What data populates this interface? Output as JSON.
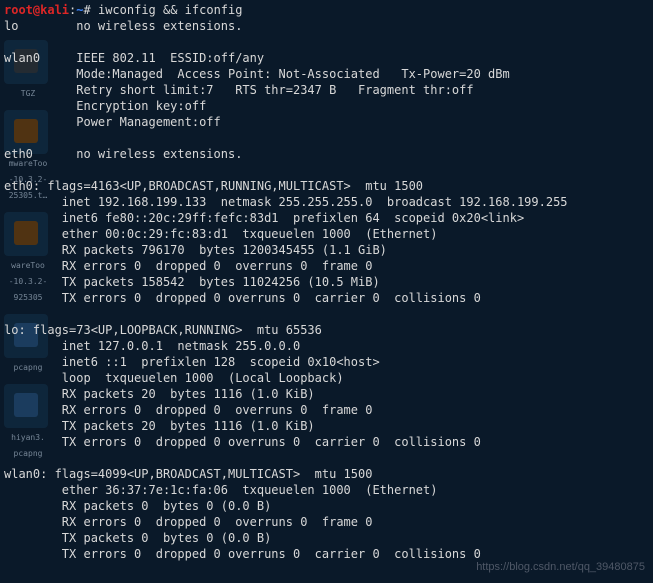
{
  "prompt_user": "root@kali",
  "prompt_path": "~",
  "prompt_sep": ":",
  "prompt_hash": "#",
  "command": "iwconfig && ifconfig",
  "iwconfig": {
    "lo": "lo        no wireless extensions.",
    "wlan0_l1": "wlan0     IEEE 802.11  ESSID:off/any",
    "wlan0_l2": "          Mode:Managed  Access Point: Not-Associated   Tx-Power=20 dBm",
    "wlan0_l3": "          Retry short limit:7   RTS thr=2347 B   Fragment thr:off",
    "wlan0_l4": "          Encryption key:off",
    "wlan0_l5": "          Power Management:off",
    "eth0": "eth0      no wireless extensions."
  },
  "ifconfig": {
    "eth0_l1": "eth0: flags=4163<UP,BROADCAST,RUNNING,MULTICAST>  mtu 1500",
    "eth0_l2": "        inet 192.168.199.133  netmask 255.255.255.0  broadcast 192.168.199.255",
    "eth0_l3": "        inet6 fe80::20c:29ff:fefc:83d1  prefixlen 64  scopeid 0x20<link>",
    "eth0_l4": "        ether 00:0c:29:fc:83:d1  txqueuelen 1000  (Ethernet)",
    "eth0_l5": "        RX packets 796170  bytes 1200345455 (1.1 GiB)",
    "eth0_l6": "        RX errors 0  dropped 0  overruns 0  frame 0",
    "eth0_l7": "        TX packets 158542  bytes 11024256 (10.5 MiB)",
    "eth0_l8": "        TX errors 0  dropped 0 overruns 0  carrier 0  collisions 0",
    "lo_l1": "lo: flags=73<UP,LOOPBACK,RUNNING>  mtu 65536",
    "lo_l2": "        inet 127.0.0.1  netmask 255.0.0.0",
    "lo_l3": "        inet6 ::1  prefixlen 128  scopeid 0x10<host>",
    "lo_l4": "        loop  txqueuelen 1000  (Local Loopback)",
    "lo_l5": "        RX packets 20  bytes 1116 (1.0 KiB)",
    "lo_l6": "        RX errors 0  dropped 0  overruns 0  frame 0",
    "lo_l7": "        TX packets 20  bytes 1116 (1.0 KiB)",
    "lo_l8": "        TX errors 0  dropped 0 overruns 0  carrier 0  collisions 0",
    "wlan0_l1": "wlan0: flags=4099<UP,BROADCAST,MULTICAST>  mtu 1500",
    "wlan0_l2": "        ether 36:37:7e:1c:fa:06  txqueuelen 1000  (Ethernet)",
    "wlan0_l3": "        RX packets 0  bytes 0 (0.0 B)",
    "wlan0_l4": "        RX errors 0  dropped 0  overruns 0  frame 0",
    "wlan0_l5": "        TX packets 0  bytes 0 (0.0 B)",
    "wlan0_l6": "        TX errors 0  dropped 0 overruns 0  carrier 0  collisions 0"
  },
  "desktop_labels": {
    "d1": "TGZ",
    "d2": "mwareToo\n-10.3.2-\n25305.t…",
    "d3": "wareToo\n-10.3.2-\n925305",
    "d4": "pcapng",
    "d5": "hiyan3.\npcapng"
  },
  "watermark": "https://blog.csdn.net/qq_39480875"
}
